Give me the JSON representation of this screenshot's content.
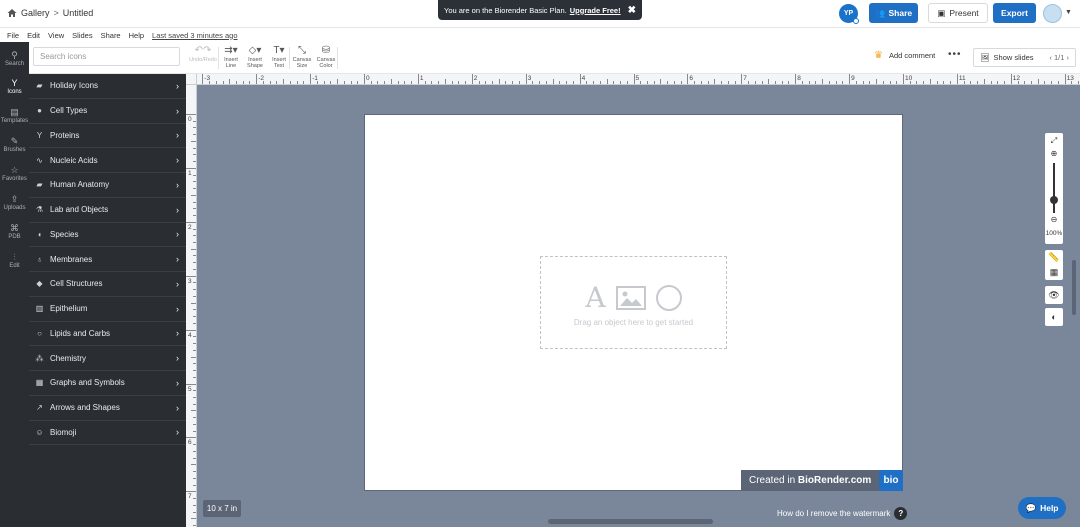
{
  "breadcrumb": {
    "home": "Gallery",
    "current": "Untitled"
  },
  "banner": {
    "text": "You are on the Biorender Basic Plan.",
    "link": "Upgrade Free!"
  },
  "header": {
    "avatar_initials": "YP",
    "share": "Share",
    "present": "Present",
    "export": "Export"
  },
  "menu": {
    "items": [
      "File",
      "Edit",
      "View",
      "Slides",
      "Share",
      "Help"
    ],
    "saved": "Last saved 3 minutes ago"
  },
  "search": {
    "placeholder": "Search icons"
  },
  "toolbar": {
    "undo_redo": "Undo/Redo",
    "insert_line": [
      "Insert",
      "Line"
    ],
    "insert_shape": [
      "Insert",
      "Shape"
    ],
    "insert_text": [
      "Insert",
      "Text"
    ],
    "canvas_size": [
      "Canvas",
      "Size"
    ],
    "canvas_color": [
      "Canvas",
      "Color"
    ],
    "add_comment": "Add comment",
    "show_slides": "Show slides",
    "slide_pager": "1/1"
  },
  "rail": [
    "Search",
    "Icons",
    "Templates",
    "Brushes",
    "Favorites",
    "Uploads",
    "PDB",
    "Edit"
  ],
  "categories": [
    "Holiday Icons",
    "Cell Types",
    "Proteins",
    "Nucleic Acids",
    "Human Anatomy",
    "Lab and Objects",
    "Species",
    "Membranes",
    "Cell Structures",
    "Epithelium",
    "Lipids and Carbs",
    "Chemistry",
    "Graphs and Symbols",
    "Arrows and Shapes",
    "Biomoji"
  ],
  "ruler": {
    "top": [
      "-3",
      "-2",
      "-1",
      "0",
      "1",
      "2",
      "3",
      "4",
      "5",
      "6",
      "7",
      "8",
      "9",
      "10",
      "11",
      "12",
      "13"
    ],
    "left": [
      "0",
      "1",
      "2",
      "3",
      "4",
      "5",
      "6",
      "7"
    ]
  },
  "canvas": {
    "dropzone_text": "Drag an object here to get started",
    "size_label": "10 x 7 in",
    "watermark_prefix": "Created in ",
    "watermark_brand": "BioRender.com",
    "watermark_logo": "bio"
  },
  "footer": {
    "remove_watermark": "How do I remove the watermark",
    "help": "Help"
  },
  "zoom": {
    "level": "100%"
  }
}
